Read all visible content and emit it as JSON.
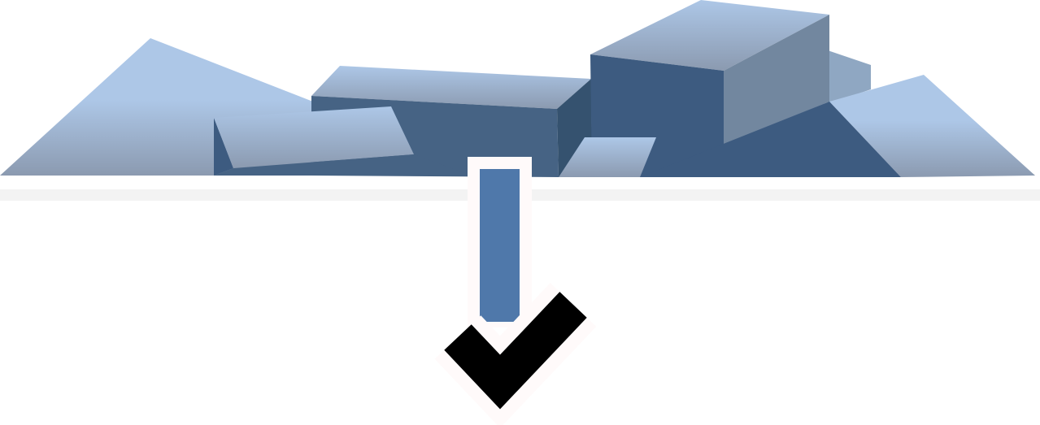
{
  "scene": {
    "background_color": "#ffffff",
    "ground_strip_color": "#f3f3f3",
    "colors": {
      "light_top": "#adc7e7",
      "light_bottom": "#8b9ab0",
      "mid_face": "#3d5b80",
      "mid_face_alt": "#466384",
      "shadow_face": "#35526f",
      "gray_face": "#72879f",
      "gray_face_light": "#8fa7c2",
      "arrow_shaft": "#4f78aa",
      "arrow_border": "#fffafa",
      "checkmark": "#000000"
    },
    "icons": {
      "landscape": "rock-pile-icon",
      "arrow": "down-arrow-shaft-icon",
      "check": "checkmark-icon"
    }
  }
}
